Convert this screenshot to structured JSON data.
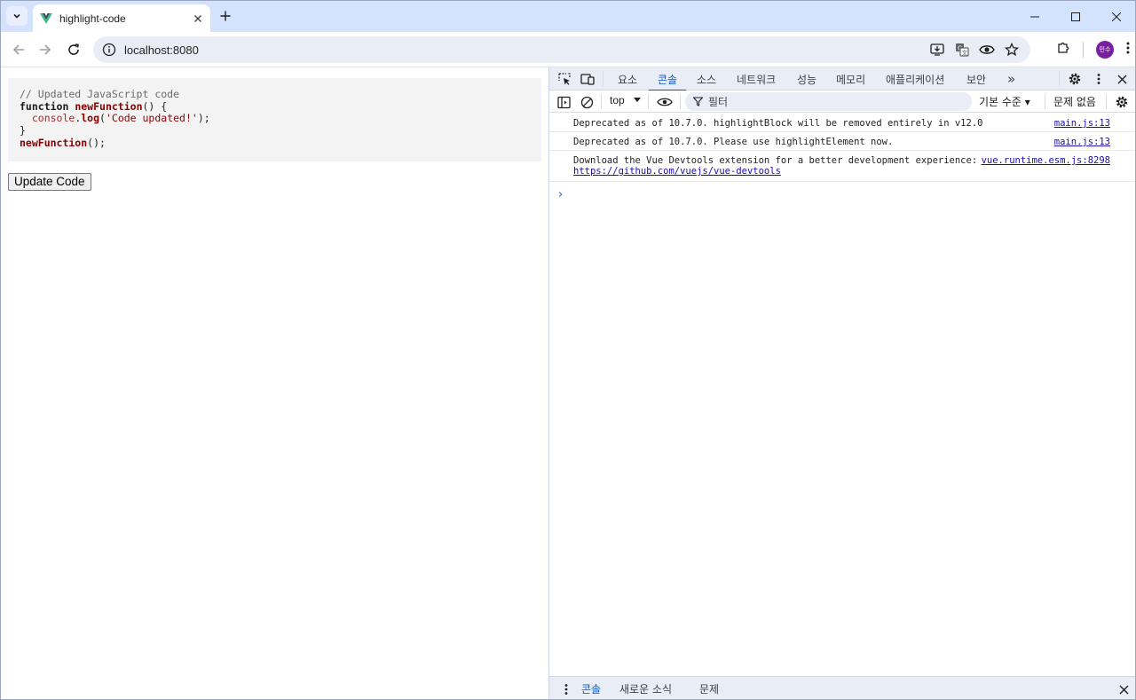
{
  "browser": {
    "tab_title": "highlight-code",
    "url": "localhost:8080",
    "avatar_text": "민수"
  },
  "page": {
    "code_lines": {
      "comment": "// Updated JavaScript code",
      "kw_function": "function",
      "fn_name": "newFunction",
      "fn_tail": "() {",
      "indent_obj": "  console",
      "dot": ".",
      "log": "log",
      "call_open": "(",
      "str": "'Code updated!'",
      "call_close": ");",
      "close_brace": "}",
      "call_name": "newFunction",
      "call_tail": "();"
    },
    "update_button": "Update Code"
  },
  "devtools": {
    "tabs": [
      "요소",
      "콘솔",
      "소스",
      "네트워크",
      "성능",
      "메모리",
      "애플리케이션",
      "보안"
    ],
    "active_tab": "콘솔",
    "more": "»",
    "context": "top",
    "filter_placeholder": "필터",
    "levels": "기본 수준 ▾",
    "issues": "문제 없음",
    "logs": [
      {
        "message": "Deprecated as of 10.7.0. highlightBlock will be removed entirely in v12.0",
        "source": "main.js:13"
      },
      {
        "message": "Deprecated as of 10.7.0. Please use highlightElement now.",
        "source": "main.js:13"
      },
      {
        "message": "Download the Vue Devtools extension for a better development experience:",
        "link": "https://github.com/vuejs/vue-devtools",
        "source": "vue.runtime.esm.js:8298"
      }
    ],
    "prompt": "›",
    "drawer_tabs": [
      "콘솔",
      "새로운 소식",
      "문제"
    ]
  },
  "colors": {
    "accent": "#0b57d0",
    "tabstrip": "#d3e3fd",
    "panel": "#e9eef6"
  }
}
